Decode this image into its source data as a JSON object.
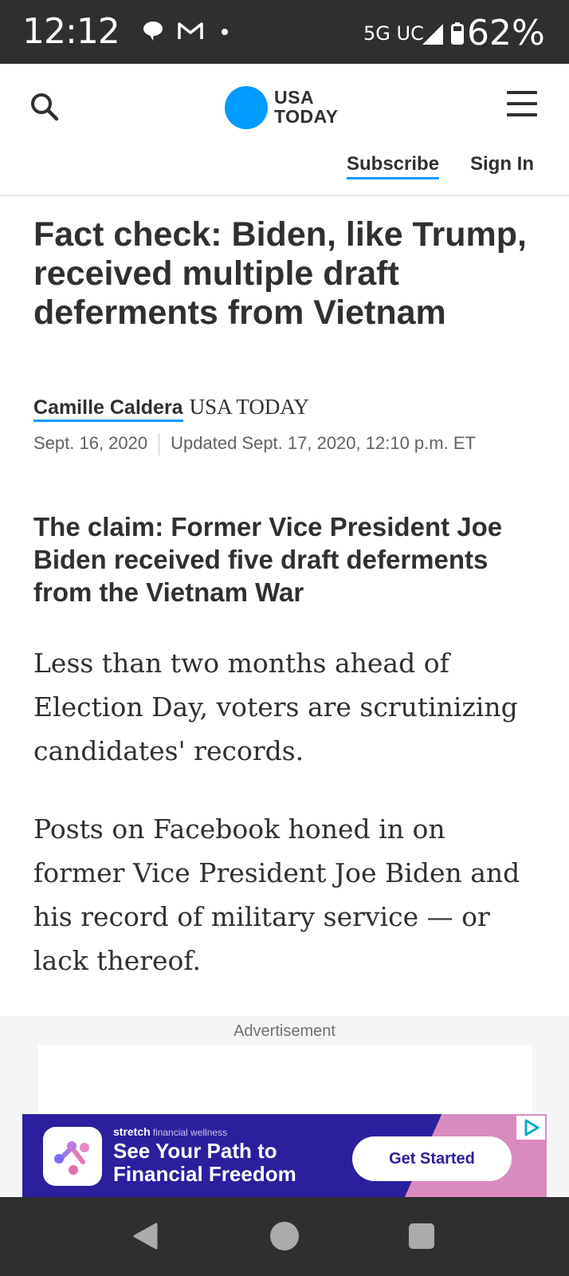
{
  "status_bar": {
    "time": "12:12",
    "network": "5G UC",
    "battery": "62%",
    "icons": [
      "chat-icon",
      "gmail-icon",
      "dot-icon",
      "signal-icon",
      "battery-icon"
    ]
  },
  "header": {
    "logo_line1": "USA",
    "logo_line2": "TODAY",
    "subscribe_label": "Subscribe",
    "signin_label": "Sign In",
    "icons": [
      "search-icon",
      "menu-icon"
    ],
    "brand_color": "#009bff"
  },
  "article": {
    "headline": "Fact check: Biden, like Trump, received multiple draft deferments from Vietnam",
    "author": "Camille Caldera",
    "publisher": "USA TODAY",
    "published": "Sept. 16, 2020",
    "updated": "Updated Sept. 17, 2020, 12:10 p.m. ET",
    "claim": "The claim: Former Vice President Joe Biden received five draft deferments from the Vietnam War",
    "paragraphs": [
      "Less than two months ahead of Election Day, voters are scrutinizing candidates' records.",
      "Posts on Facebook honed in on former Vice President Joe Biden and his record of military service — or lack thereof."
    ]
  },
  "advertisement": {
    "label": "Advertisement",
    "banner": {
      "brand": "stretch",
      "brand_tagline": "financial wellness",
      "headline": "See Your Path to Financial Freedom",
      "cta": "Get Started",
      "background": "#2c1f9e"
    }
  },
  "nav_bar": {
    "icons": [
      "back-icon",
      "home-icon",
      "recent-apps-icon"
    ]
  }
}
